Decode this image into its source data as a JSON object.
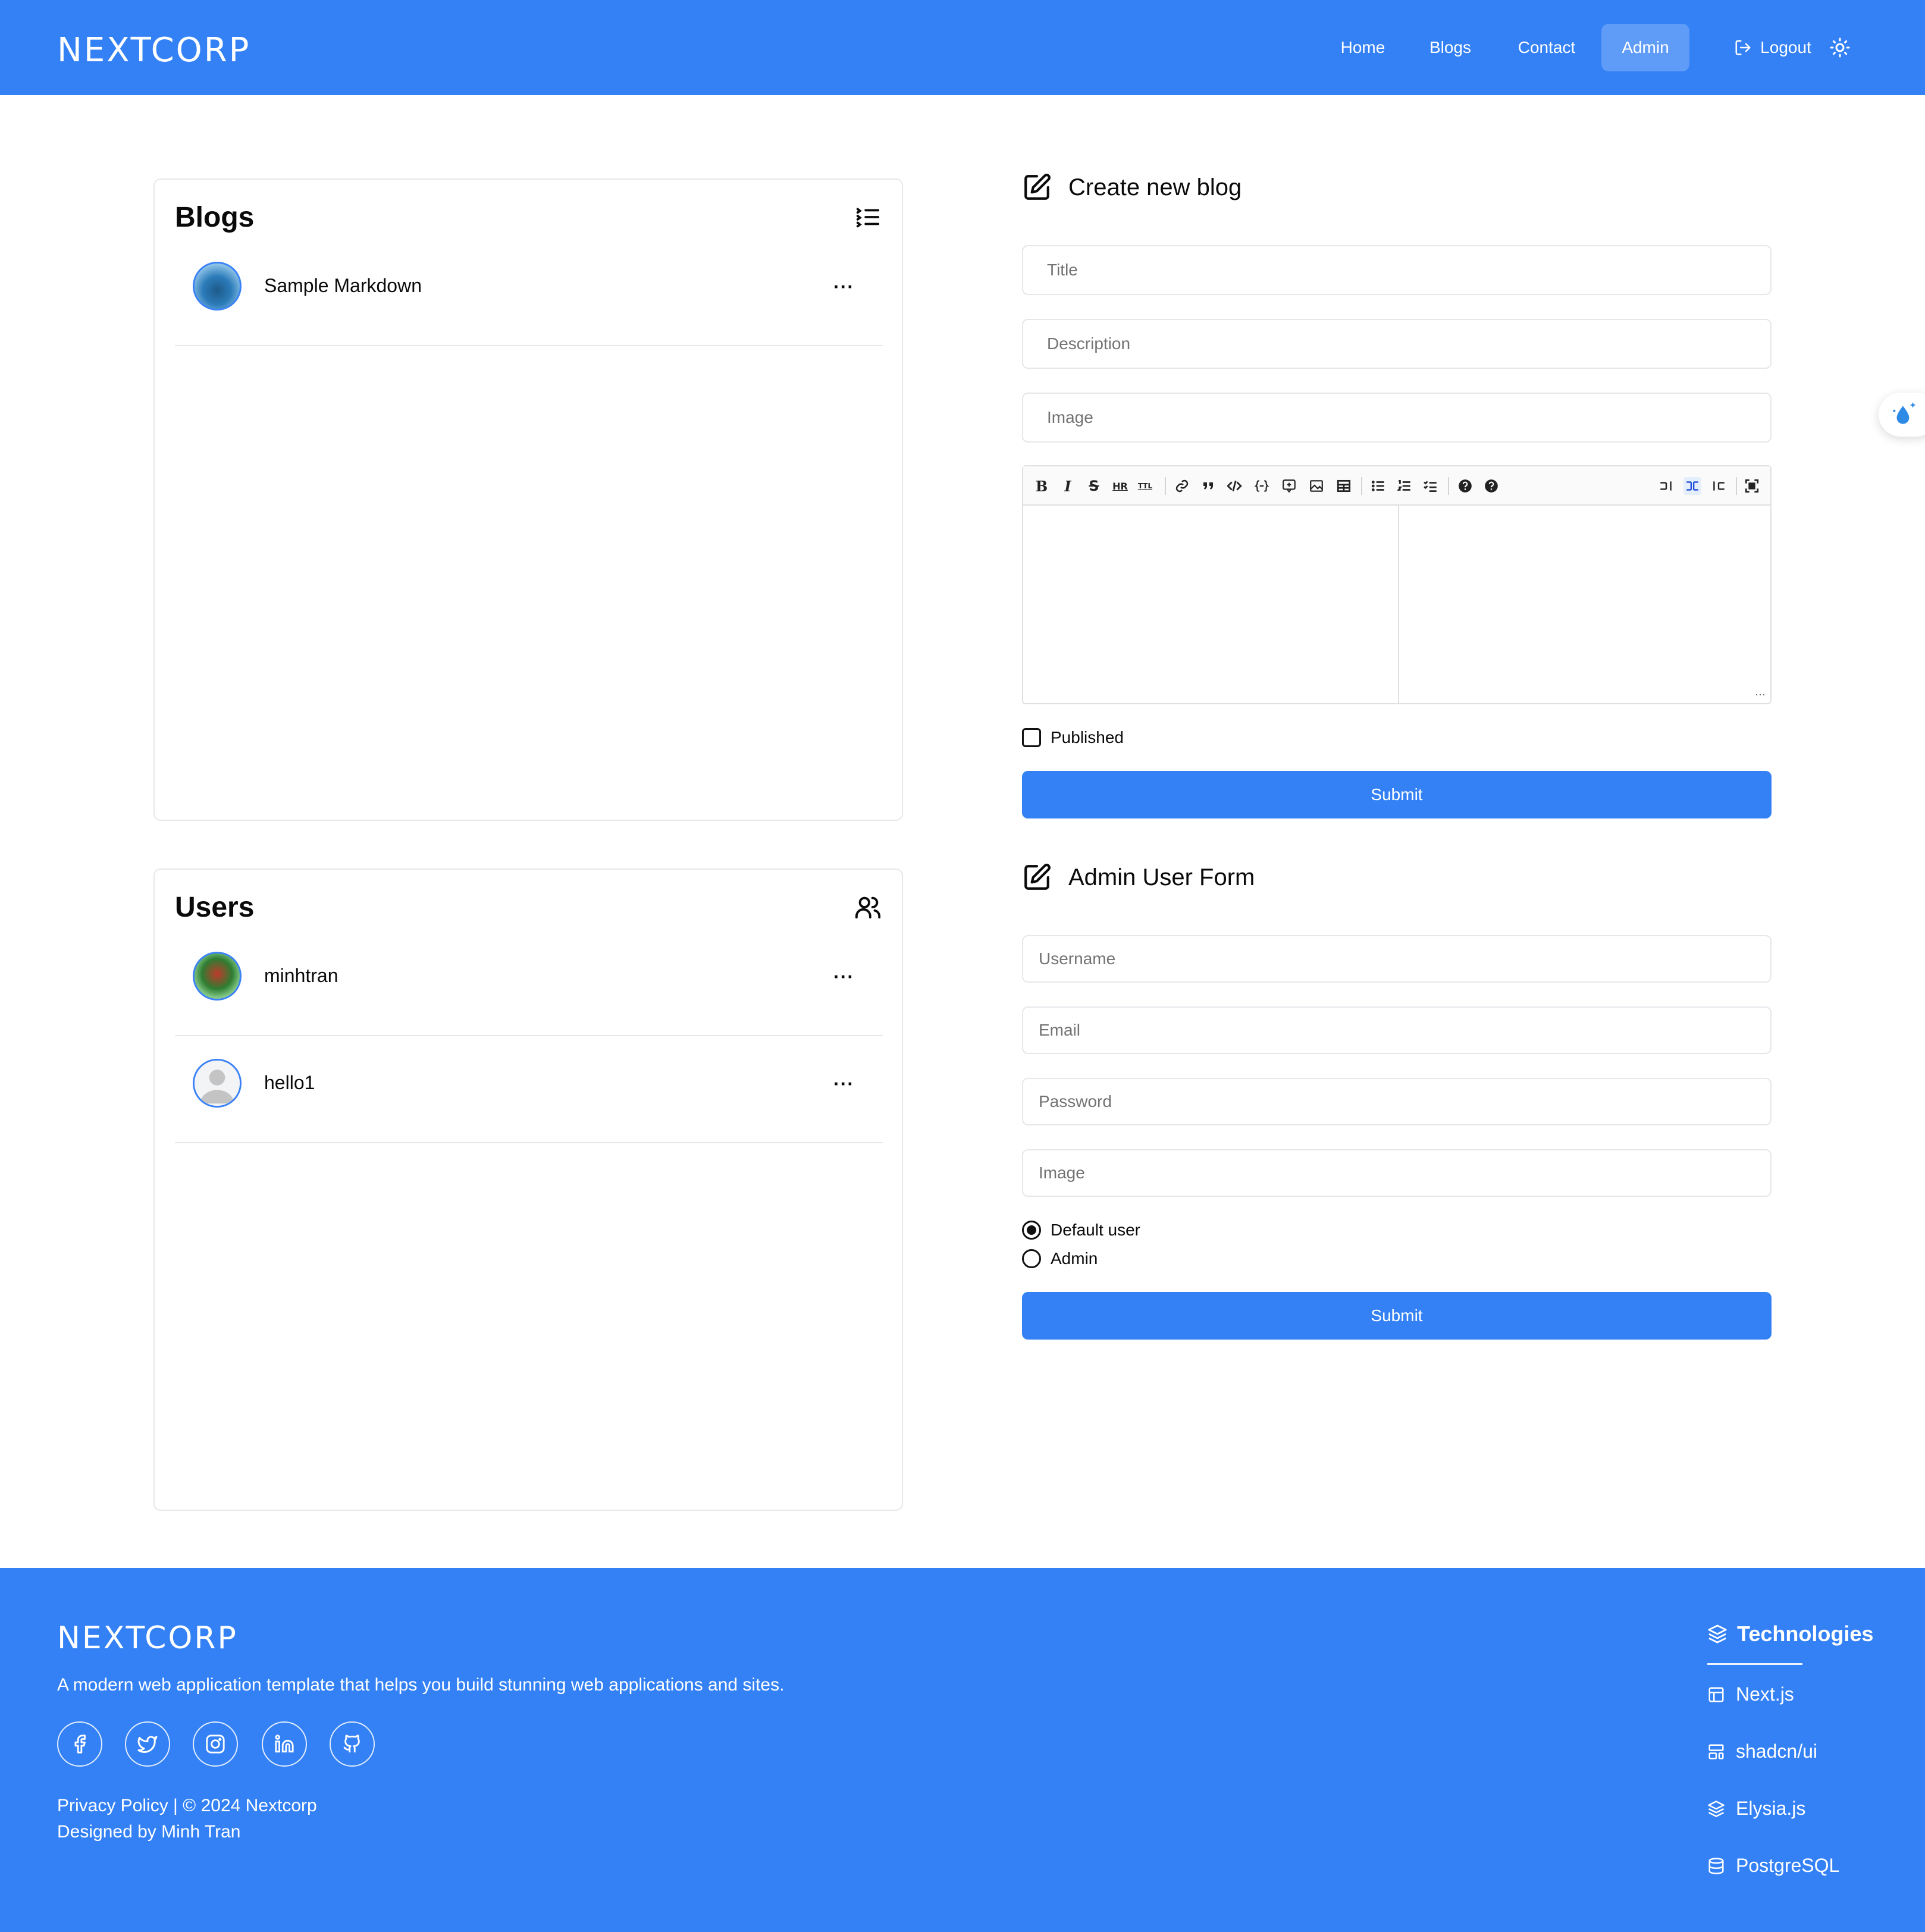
{
  "header": {
    "logo": "NEXTCORP",
    "nav": {
      "home": "Home",
      "blogs": "Blogs",
      "contact": "Contact",
      "admin": "Admin",
      "logout": "Logout"
    }
  },
  "blogs_card": {
    "title": "Blogs",
    "items": [
      {
        "label": "Sample Markdown",
        "more": "···"
      }
    ]
  },
  "users_card": {
    "title": "Users",
    "items": [
      {
        "label": "minhtran",
        "more": "···"
      },
      {
        "label": "hello1",
        "more": "···"
      }
    ]
  },
  "blog_form": {
    "heading": "Create new blog",
    "title_placeholder": "Title",
    "description_placeholder": "Description",
    "image_placeholder": "Image",
    "editor_toolbar": {
      "bold": "B",
      "italic": "I",
      "strike": "S",
      "hr": "HR",
      "title": "TTL"
    },
    "editor_grip": "···",
    "published_label": "Published",
    "submit_label": "Submit"
  },
  "user_form": {
    "heading": "Admin User Form",
    "username_placeholder": "Username",
    "email_placeholder": "Email",
    "password_placeholder": "Password",
    "image_placeholder": "Image",
    "role_options": [
      {
        "label": "Default user",
        "selected": true
      },
      {
        "label": "Admin",
        "selected": false
      }
    ],
    "submit_label": "Submit"
  },
  "footer": {
    "logo": "NEXTCORP",
    "tagline": "A modern web application template that helps you build stunning web applications and sites.",
    "legal_line1": "Privacy Policy | © 2024 Nextcorp",
    "legal_line2": "Designed by Minh Tran",
    "tech_heading": "Technologies",
    "tech_items": [
      "Next.js",
      "shadcn/ui",
      "Elysia.js",
      "PostgreSQL"
    ]
  },
  "colors": {
    "brand": "#3381f5",
    "border": "#e5e7eb",
    "placeholder": "#737373",
    "avatar_ring": "#3b82f6"
  }
}
